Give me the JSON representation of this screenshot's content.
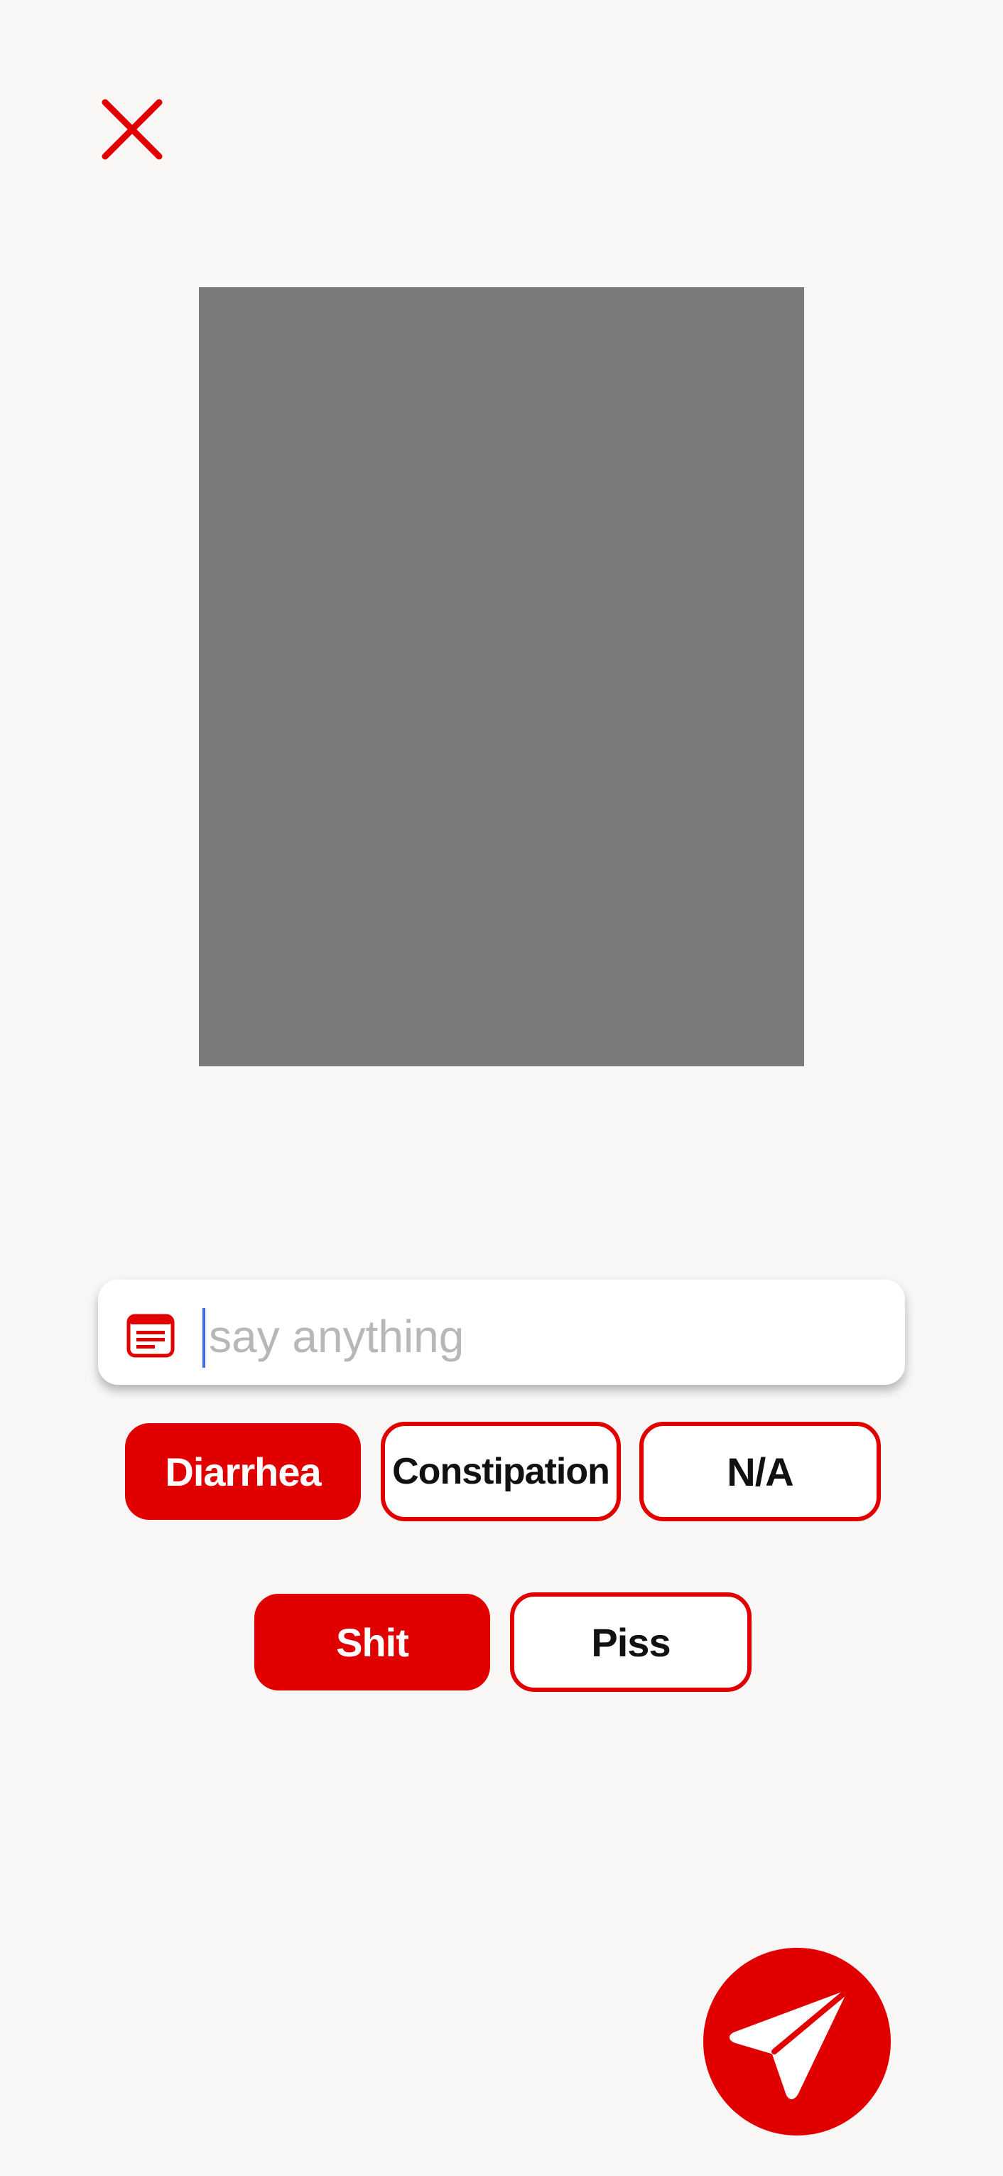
{
  "header": {
    "close_icon": "close-x-icon"
  },
  "photo": {
    "placeholder_color": "#7a7a7a"
  },
  "composer": {
    "icon": "note-icon",
    "placeholder": "say anything",
    "value": ""
  },
  "categories": {
    "row1": [
      {
        "label": "Diarrhea",
        "selected": true
      },
      {
        "label": "Constipation",
        "selected": false
      },
      {
        "label": "N/A",
        "selected": false
      }
    ],
    "row2": [
      {
        "label": "Shit",
        "selected": true
      },
      {
        "label": "Piss",
        "selected": false
      }
    ]
  },
  "send": {
    "icon": "paper-plane-icon"
  },
  "colors": {
    "accent": "#e00000",
    "background": "#f8f7f6",
    "caret": "#3b6df0"
  }
}
